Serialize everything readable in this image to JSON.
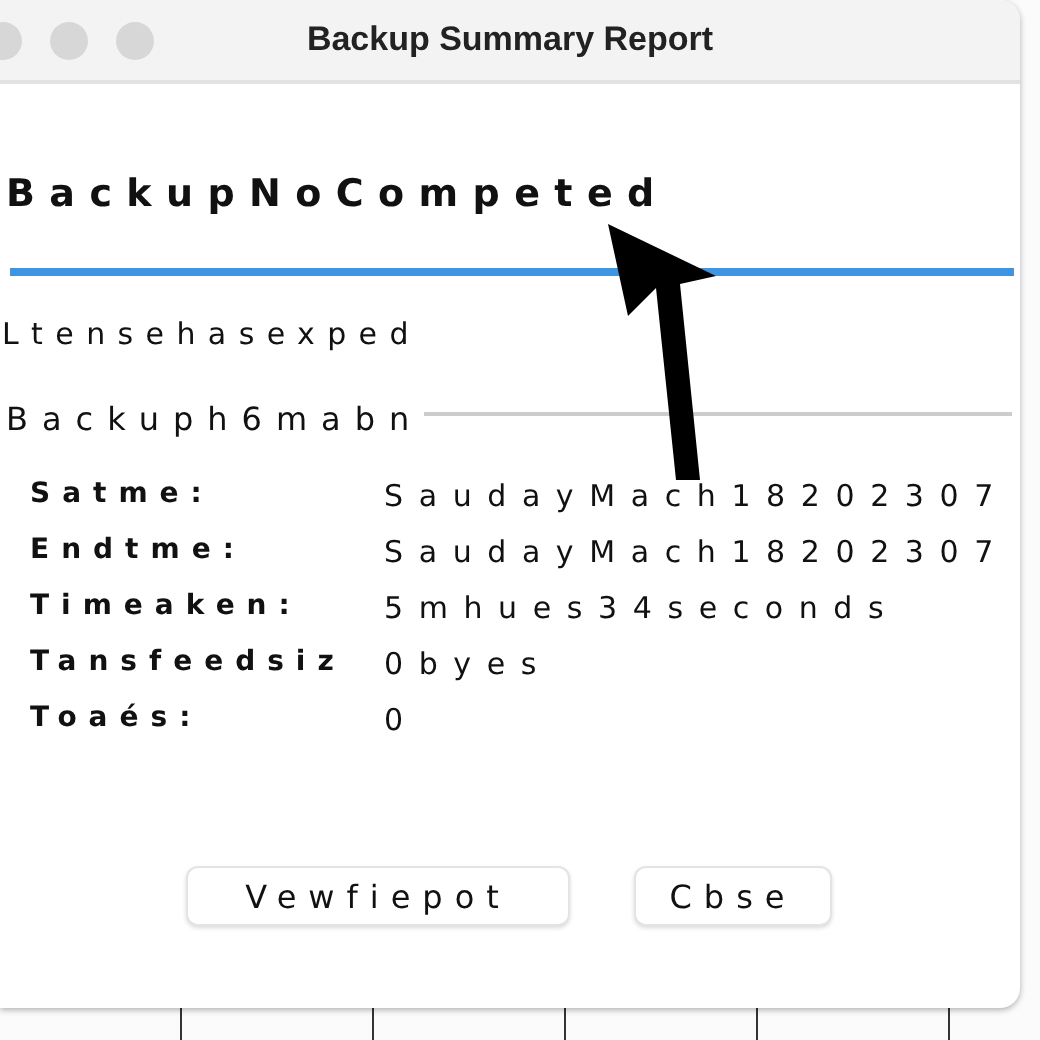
{
  "window": {
    "title": "Backup Summary Report"
  },
  "heading": "BackupNoCompeted",
  "message": "Ltensehasexped",
  "section_title": "Backuph6mabn",
  "details": [
    {
      "label": "Satme:",
      "value": "SaudayMach18202307"
    },
    {
      "label": "Endtme:",
      "value": "SaudayMach18202307"
    },
    {
      "label": "Timeaken:",
      "value": "5mhues34seconds"
    },
    {
      "label": "Tansfeedsiz",
      "value": "0byes"
    },
    {
      "label": "Toaés:",
      "value": "0"
    }
  ],
  "buttons": [
    "Vewfiepot",
    "Cbse"
  ]
}
